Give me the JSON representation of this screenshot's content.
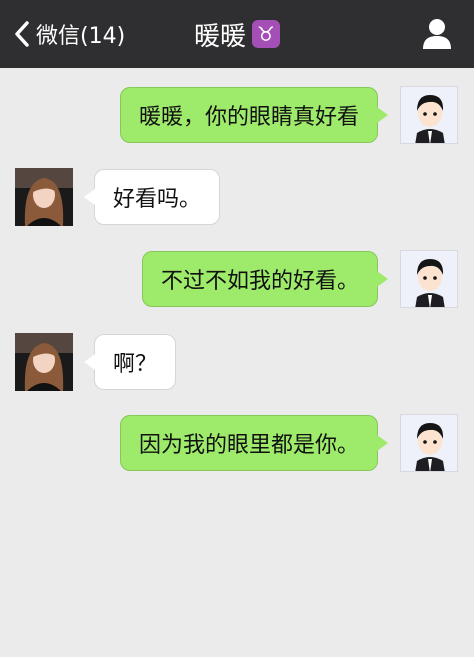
{
  "header": {
    "back_label": "微信(14)",
    "title": "暖暖",
    "zodiac_symbol": "♉",
    "zodiac_color": "#a44fb6",
    "back_icon": "chevron-left-icon",
    "profile_icon": "person-icon"
  },
  "messages": [
    {
      "from": "me",
      "text": "暖暖，你的眼睛真好看"
    },
    {
      "from": "her",
      "text": "好看吗。"
    },
    {
      "from": "me",
      "text": "不过不如我的好看。"
    },
    {
      "from": "her",
      "text": "啊？"
    },
    {
      "from": "me",
      "text": "因为我的眼里都是你。"
    }
  ],
  "colors": {
    "topbar": "#2f2f31",
    "background": "#ebebeb",
    "outgoing_bubble": "#9eea6a",
    "incoming_bubble": "#ffffff"
  }
}
